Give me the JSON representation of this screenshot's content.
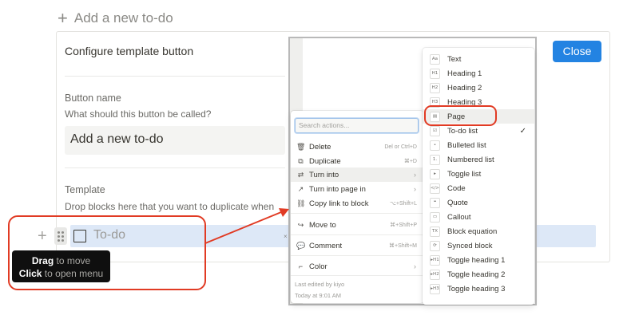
{
  "top": {
    "add_label": "Add a new to-do"
  },
  "config": {
    "title": "Configure template button",
    "button_name_label": "Button name",
    "button_name_hint": "What should this button be called?",
    "button_name_value": "Add a new to-do",
    "template_label": "Template",
    "template_hint": "Drop blocks here that you want to duplicate when"
  },
  "close_label": "Close",
  "todo": {
    "text": "To-do"
  },
  "tooltip": {
    "line1_strong": "Drag",
    "line1_rest": " to move",
    "line2_strong": "Click",
    "line2_rest": " to open menu"
  },
  "actions_menu": {
    "search_placeholder": "Search actions...",
    "items": [
      {
        "label": "Delete",
        "shortcut": "Del or Ctrl+D",
        "icon": "trash-icon"
      },
      {
        "label": "Duplicate",
        "shortcut": "⌘+D",
        "icon": "duplicate-icon"
      },
      {
        "label": "Turn into",
        "shortcut": "",
        "icon": "turn-into-icon",
        "submenu": true
      },
      {
        "label": "Turn into page in",
        "shortcut": "",
        "icon": "page-arrow-icon",
        "submenu": true
      },
      {
        "label": "Copy link to block",
        "shortcut": "⌥+Shift+L",
        "icon": "link-icon"
      },
      {
        "label": "Move to",
        "shortcut": "⌘+Shift+P",
        "icon": "move-arrow-icon"
      },
      {
        "label": "Comment",
        "shortcut": "⌘+Shift+M",
        "icon": "comment-icon"
      },
      {
        "label": "Color",
        "shortcut": "",
        "icon": "paint-roller-icon",
        "submenu": true
      }
    ],
    "edited_by": "Last edited by kiyo",
    "edited_at": "Today at 9:01 AM"
  },
  "turn_into_menu": {
    "items": [
      {
        "label": "Text",
        "icon_glyph": "Aa"
      },
      {
        "label": "Heading 1",
        "icon_glyph": "H1"
      },
      {
        "label": "Heading 2",
        "icon_glyph": "H2"
      },
      {
        "label": "Heading 3",
        "icon_glyph": "H3"
      },
      {
        "label": "Page",
        "icon_glyph": "▤"
      },
      {
        "label": "To-do list",
        "icon_glyph": "☑",
        "checked": true
      },
      {
        "label": "Bulleted list",
        "icon_glyph": "•"
      },
      {
        "label": "Numbered list",
        "icon_glyph": "1."
      },
      {
        "label": "Toggle list",
        "icon_glyph": "▸"
      },
      {
        "label": "Code",
        "icon_glyph": "</>"
      },
      {
        "label": "Quote",
        "icon_glyph": "❝"
      },
      {
        "label": "Callout",
        "icon_glyph": "▭"
      },
      {
        "label": "Block equation",
        "icon_glyph": "TX"
      },
      {
        "label": "Synced block",
        "icon_glyph": "⟳"
      },
      {
        "label": "Toggle heading 1",
        "icon_glyph": "▸H1"
      },
      {
        "label": "Toggle heading 2",
        "icon_glyph": "▸H2"
      },
      {
        "label": "Toggle heading 3",
        "icon_glyph": "▸H3"
      }
    ]
  },
  "colors": {
    "accent": "#2383e2",
    "annotation": "#e13b24",
    "selection": "#dde8f7"
  }
}
